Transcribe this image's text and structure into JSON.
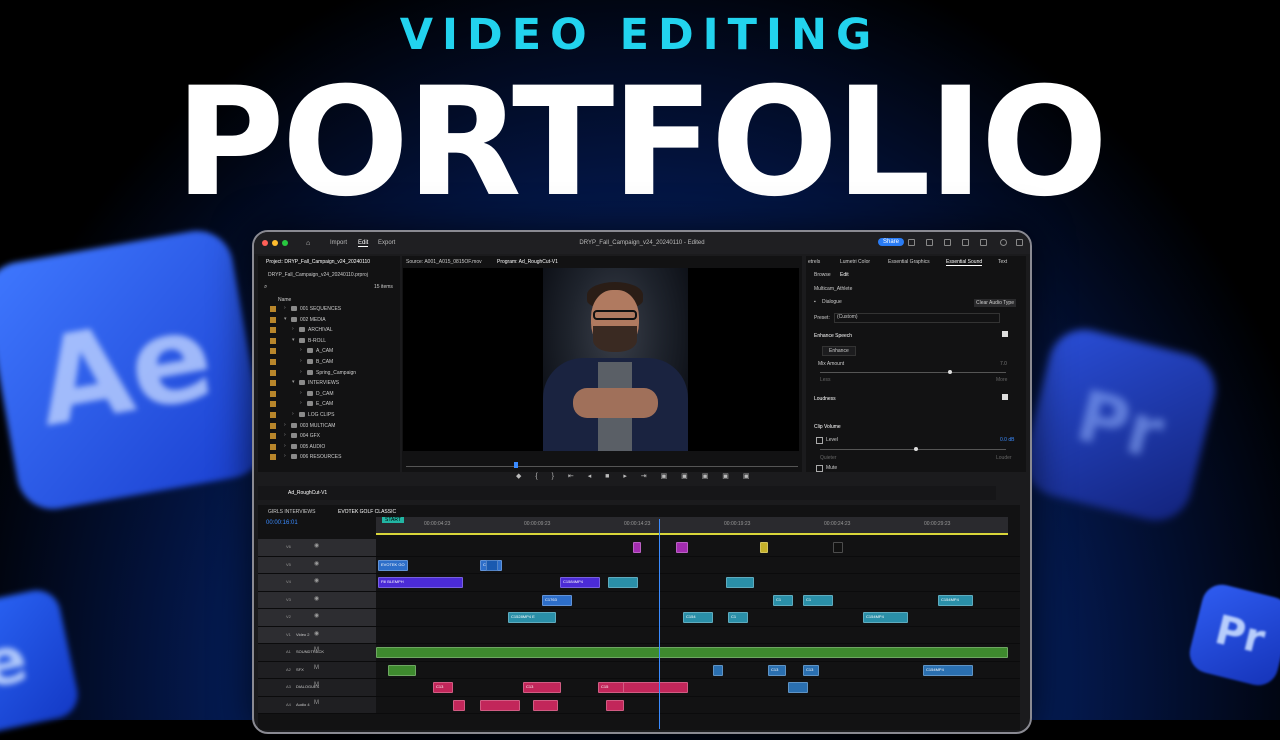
{
  "headline": {
    "subtitle": "VIDEO EDITING",
    "title": "PORTFOLIO"
  },
  "app_icons": [
    "Ae",
    "e",
    "Pr",
    "Pr"
  ],
  "topbar": {
    "tabs": [
      "Import",
      "Edit",
      "Export"
    ],
    "title": "DRYP_Fall_Campaign_v24_20240110 - Edited",
    "share": "Share"
  },
  "project": {
    "tab": "Project: DRYP_Fall_Campaign_v24_20240110",
    "file": "DRYP_Fall_Campaign_v24_20240110.prproj",
    "count": "15 items",
    "col_name": "Name",
    "items": [
      {
        "label": "001 SEQUENCES",
        "depth": 0,
        "open": false
      },
      {
        "label": "002 MEDIA",
        "depth": 0,
        "open": true
      },
      {
        "label": "ARCHIVAL",
        "depth": 1,
        "open": false
      },
      {
        "label": "B-ROLL",
        "depth": 1,
        "open": true
      },
      {
        "label": "A_CAM",
        "depth": 2,
        "open": false
      },
      {
        "label": "B_CAM",
        "depth": 2,
        "open": false
      },
      {
        "label": "Spring_Campaign",
        "depth": 2,
        "open": false
      },
      {
        "label": "INTERVIEWS",
        "depth": 1,
        "open": true
      },
      {
        "label": "D_CAM",
        "depth": 2,
        "open": false
      },
      {
        "label": "E_CAM",
        "depth": 2,
        "open": false
      },
      {
        "label": "LOG CLIPS",
        "depth": 1,
        "open": false
      },
      {
        "label": "003 MULTICAM",
        "depth": 0,
        "open": false
      },
      {
        "label": "004 GFX",
        "depth": 0,
        "open": false
      },
      {
        "label": "005 AUDIO",
        "depth": 0,
        "open": false
      },
      {
        "label": "006 RESOURCES",
        "depth": 0,
        "open": false
      }
    ]
  },
  "monitor": {
    "source_tab": "Source: A001_A015_0815OF.mov",
    "program_tab": "Program: Ad_RoughCut-V1"
  },
  "essential_sound": {
    "tabs": [
      "etrels",
      "Lumetri Color",
      "Essential Graphics",
      "Essential Sound",
      "Text"
    ],
    "subtabs": [
      "Browse",
      "Edit"
    ],
    "clip_name": "Multicam_Athlete",
    "type": "Dialogue",
    "clear": "Clear Audio Type",
    "preset_label": "Preset:",
    "preset_value": "(Custom)",
    "enhance_speech": "Enhance Speech",
    "enhance_btn": "Enhance",
    "mix_amount": "Mix Amount",
    "mix_value": "7.0",
    "less": "Less",
    "more": "More",
    "loudness": "Loudness",
    "clip_volume": "Clip Volume",
    "level": "Level",
    "level_value": "0.0 dB",
    "quieter": "Quieter",
    "louder": "Louder",
    "mute": "Mute"
  },
  "timeline": {
    "seq_tab": "Ad_RoughCut-V1",
    "bin_tabs": [
      "GIRLS INTERVIEWS",
      "EVOTEK GOLF CLASSIC"
    ],
    "timecode": "00:00:16:01",
    "ruler": [
      "00:00:04:23",
      "00:00:09:23",
      "00:00:14:23",
      "00:00:19:23",
      "00:00:24:23",
      "00:00:29:23"
    ],
    "start_marker": "START",
    "tracks": [
      {
        "id": "V6",
        "name": ""
      },
      {
        "id": "V5",
        "name": ""
      },
      {
        "id": "V4",
        "name": ""
      },
      {
        "id": "V3",
        "name": ""
      },
      {
        "id": "V2",
        "name": ""
      },
      {
        "id": "V1",
        "name": "Video 2"
      },
      {
        "id": "A1",
        "name": "SOUNDTRACK"
      },
      {
        "id": "A2",
        "name": "SFX"
      },
      {
        "id": "A3",
        "name": "DIALOGUES"
      },
      {
        "id": "A4",
        "name": "Audio 4"
      }
    ],
    "clip_labels": [
      "EVOTEK GO",
      "SCEN",
      "ENG",
      "Fill BLEMPH",
      "C176",
      "C1584MP4",
      "C1763",
      "C1584MP4",
      "C1528MP4 E",
      "C154",
      "C1",
      "C1",
      "C154MP4",
      "C1",
      "C154MP4",
      "C13",
      "C13",
      "C13",
      "C13",
      "C15",
      "C154MP4"
    ]
  }
}
